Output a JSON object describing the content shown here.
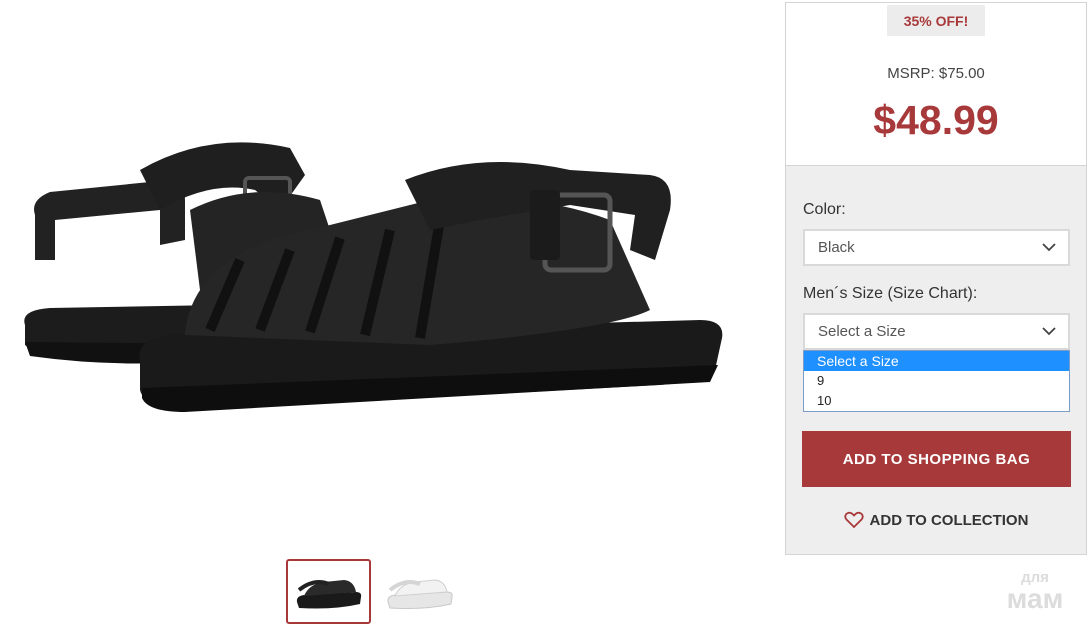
{
  "pricing": {
    "discount_badge": "35% OFF!",
    "msrp": "MSRP: $75.00",
    "price": "$48.99"
  },
  "options": {
    "color_label": "Color:",
    "color_value": "Black",
    "size_label": "Men´s Size (Size Chart):",
    "size_value": "Select a Size",
    "size_options": [
      "Select a Size",
      "9",
      "10"
    ]
  },
  "actions": {
    "add_to_bag": "ADD TO SHOPPING BAG",
    "add_to_collection": "ADD TO COLLECTION"
  },
  "gallery": {
    "thumbnails": [
      "black-sandal",
      "clear-sandal"
    ],
    "active_index": 0
  },
  "watermark": {
    "line1": "для",
    "line2": "мам"
  },
  "colors": {
    "accent": "#a8393a",
    "panel_bg": "#eeeeee",
    "selected_option": "#1e90ff"
  }
}
